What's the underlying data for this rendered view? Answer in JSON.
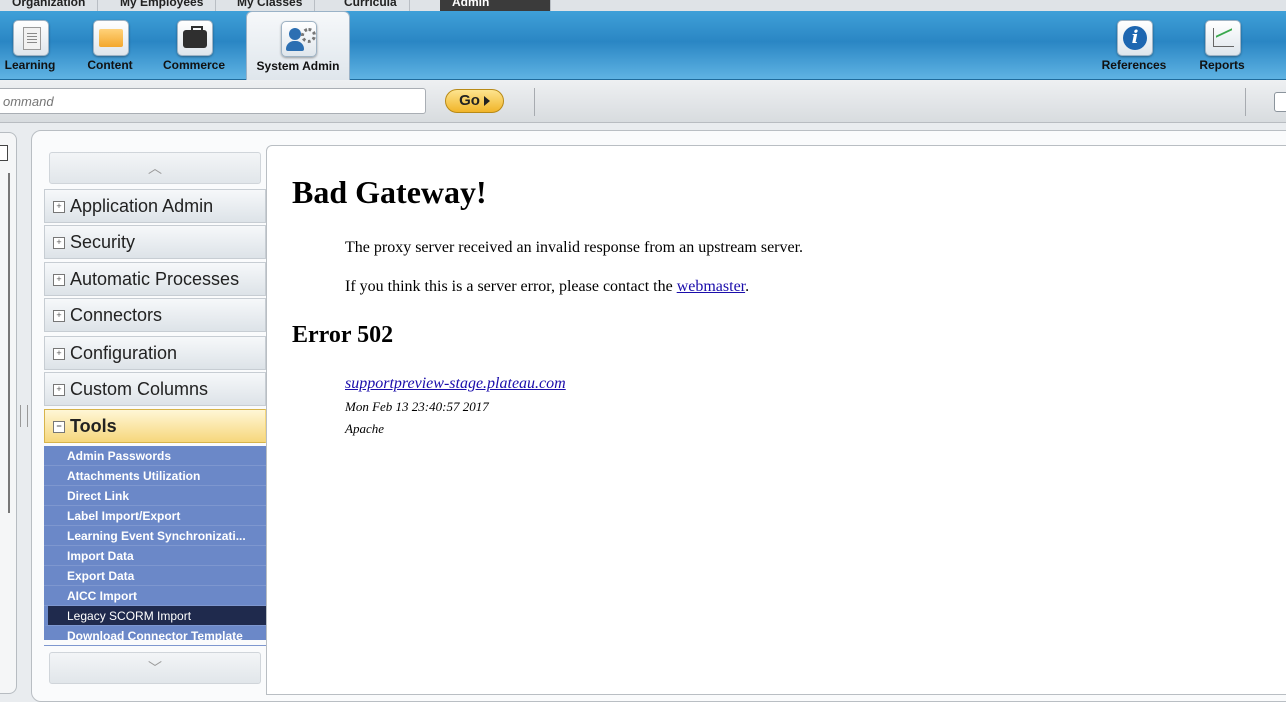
{
  "top_tabs": [
    {
      "label": "Organization"
    },
    {
      "label": "My Employees"
    },
    {
      "label": "My Classes"
    },
    {
      "label": "Curricula"
    },
    {
      "label": "Admin"
    }
  ],
  "modules": {
    "learning": "Learning",
    "content": "Content",
    "commerce": "Commerce",
    "system_admin": "System Admin",
    "references": "References",
    "reports": "Reports"
  },
  "command": {
    "placeholder": "ommand",
    "go_label": "Go"
  },
  "nav": {
    "sections": [
      {
        "label": "Application Admin",
        "toggle": "+"
      },
      {
        "label": "Security",
        "toggle": "+"
      },
      {
        "label": "Automatic Processes",
        "toggle": "+"
      },
      {
        "label": "Connectors",
        "toggle": "+"
      },
      {
        "label": "Configuration",
        "toggle": "+"
      },
      {
        "label": "Custom Columns",
        "toggle": "+"
      },
      {
        "label": "Tools",
        "toggle": "−"
      }
    ],
    "tools_items": [
      "Admin Passwords",
      "Attachments Utilization",
      "Direct Link",
      "Label Import/Export",
      "Learning Event Synchronizati...",
      "Import Data",
      "Export Data",
      "AICC Import",
      "Legacy SCORM Import",
      "Download Connector Template"
    ],
    "scroll_up": "︿",
    "scroll_down": "﹀"
  },
  "error": {
    "title": "Bad Gateway!",
    "message": "The proxy server received an invalid response from an upstream server.",
    "contact_prefix": "If you think this is a server error, please contact the ",
    "contact_link": "webmaster",
    "contact_suffix": ".",
    "code": "Error 502",
    "host": "supportpreview-stage.plateau.com",
    "datetime": "Mon Feb 13 23:40:57 2017",
    "server": "Apache"
  },
  "colors": {
    "accent_blue": "#2a86c4",
    "tools_blue": "#6b88c8",
    "selected_item": "#1f2a4d",
    "go_yellow": "#f1b52a"
  }
}
